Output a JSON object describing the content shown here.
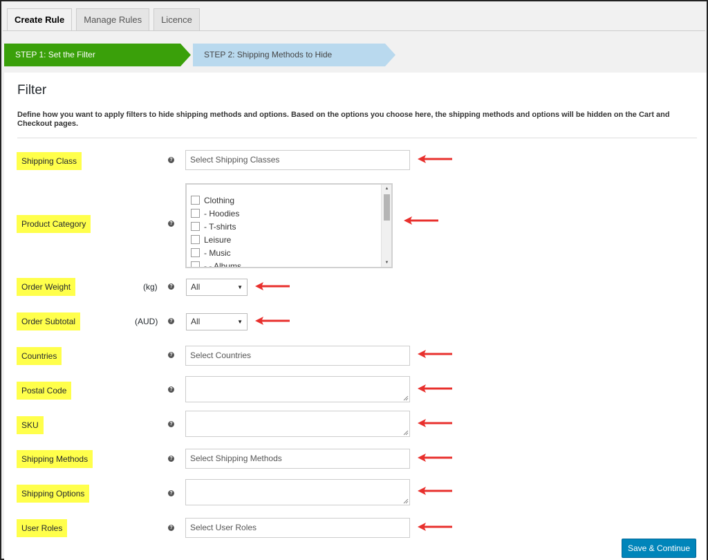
{
  "tabs": [
    {
      "label": "Create Rule",
      "active": true
    },
    {
      "label": "Manage Rules",
      "active": false
    },
    {
      "label": "Licence",
      "active": false
    }
  ],
  "steps": {
    "step1": "STEP 1: Set the Filter",
    "step2": "STEP 2: Shipping Methods to Hide"
  },
  "filter": {
    "title": "Filter",
    "description": "Define how you want to apply filters to hide shipping methods and options. Based on the options you choose here, the shipping methods and options will be hidden on the Cart and Checkout pages."
  },
  "fields": {
    "shipping_class": {
      "label": "Shipping Class",
      "placeholder": "Select Shipping Classes"
    },
    "product_category": {
      "label": "Product Category",
      "options": [
        "Clothing",
        "- Hoodies",
        "- T-shirts",
        "Leisure",
        "- Music",
        "- - Albums"
      ]
    },
    "order_weight": {
      "label": "Order Weight",
      "unit": "(kg)",
      "value": "All"
    },
    "order_subtotal": {
      "label": "Order Subtotal",
      "unit": "(AUD)",
      "value": "All"
    },
    "countries": {
      "label": "Countries",
      "placeholder": "Select Countries"
    },
    "postal_code": {
      "label": "Postal Code"
    },
    "sku": {
      "label": "SKU"
    },
    "shipping_methods": {
      "label": "Shipping Methods",
      "placeholder": "Select Shipping Methods"
    },
    "shipping_options": {
      "label": "Shipping Options"
    },
    "user_roles": {
      "label": "User Roles",
      "placeholder": "Select User Roles"
    }
  },
  "help_glyph": "?",
  "save_button": "Save & Continue",
  "colors": {
    "step_active": "#3aa00a",
    "step_inactive": "#b9d9ee",
    "highlight": "#ffff4b",
    "annotation_arrow": "#e8302d",
    "primary_button": "#0085ba"
  }
}
